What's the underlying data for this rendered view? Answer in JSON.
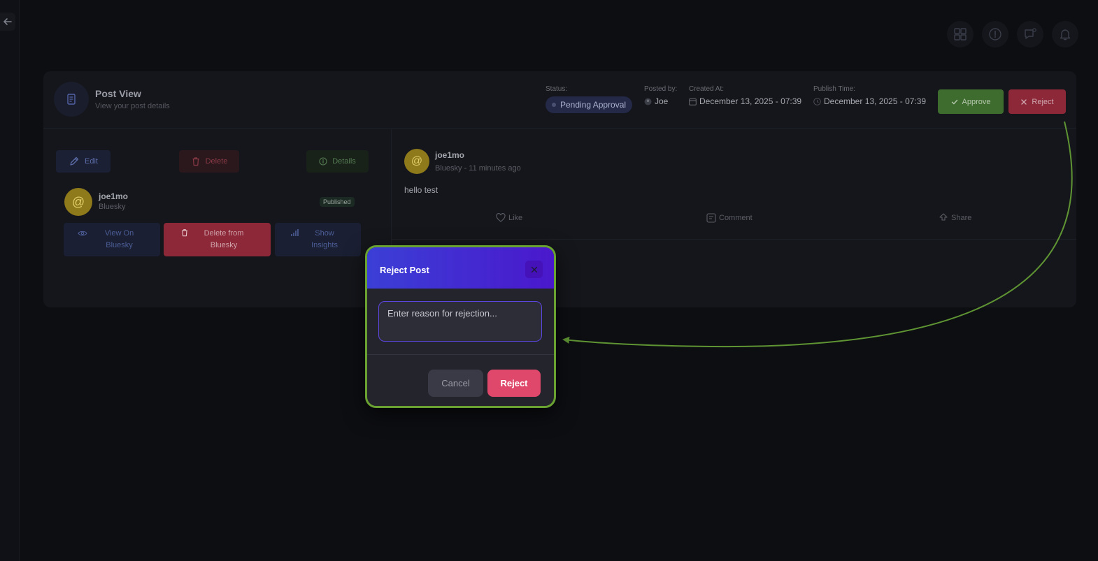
{
  "header": {
    "title": "Post View",
    "subtitle": "View your post details",
    "status_label": "Status:",
    "status_value": "Pending Approval",
    "posted_by_label": "Posted by:",
    "posted_by_value": "Joe",
    "created_label": "Created At:",
    "created_value": "December 13, 2025 - 07:39",
    "publish_label": "Publish Time:",
    "publish_value": "December 13, 2025 - 07:39",
    "approve_label": "Approve",
    "reject_label": "Reject"
  },
  "left_panel": {
    "edit_label": "Edit",
    "delete_label": "Delete",
    "details_label": "Details",
    "account": {
      "avatar_glyph": "@",
      "name": "joe1mo",
      "platform": "Bluesky",
      "status_badge": "Published"
    },
    "view_label": "View On Bluesky",
    "delete_bsky_label": "Delete from Bluesky",
    "insights_label": "Show Insights"
  },
  "post": {
    "avatar_glyph": "@",
    "username": "joe1mo",
    "meta": "Bluesky - 11 minutes ago",
    "text": "hello test",
    "like_label": "Like",
    "comment_label": "Comment",
    "share_label": "Share"
  },
  "modal": {
    "title": "Reject Post",
    "reason_placeholder": "Enter reason for rejection...",
    "cancel_label": "Cancel",
    "reject_label": "Reject"
  },
  "colors": {
    "approve": "#3e6c2f",
    "reject": "#e0486b",
    "modal_header_start": "#3b3fd6",
    "modal_header_end": "#4a18cc",
    "highlight": "#6aa232"
  }
}
